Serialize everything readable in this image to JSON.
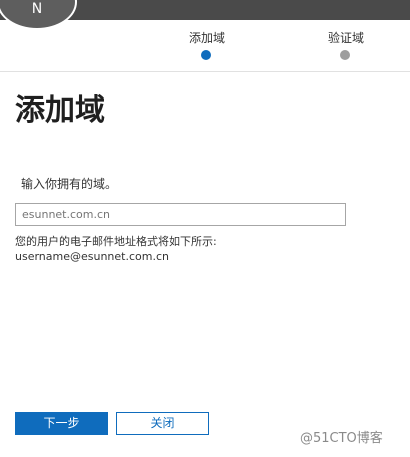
{
  "header": {
    "avatar_initial": "N"
  },
  "steps": [
    {
      "label": "添加域",
      "state": "active"
    },
    {
      "label": "验证域",
      "state": "inactive"
    }
  ],
  "main": {
    "title": "添加域",
    "prompt": "输入你拥有的域。",
    "domain_input": {
      "value": "",
      "placeholder": "esunnet.com.cn"
    },
    "format_label": "您的用户的电子邮件地址格式将如下所示:",
    "format_example": "username@esunnet.com.cn"
  },
  "buttons": {
    "next_label": "下一步",
    "close_label": "关闭"
  },
  "watermark": "@51CTO博客",
  "colors": {
    "accent": "#0f6cbd",
    "topbar": "#4a4a4a",
    "inactive_dot": "#9e9e9e"
  }
}
